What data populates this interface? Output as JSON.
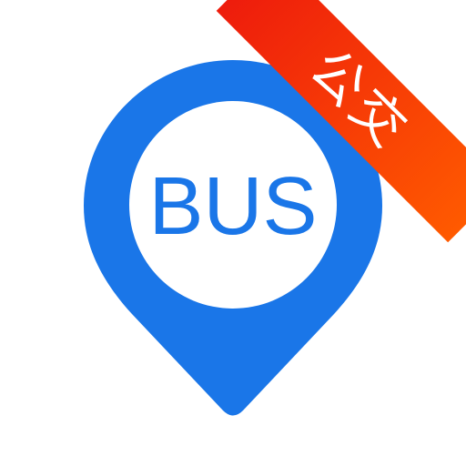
{
  "icon": {
    "label": "BUS",
    "ribbon_text": "公交",
    "pin_icon": "map-pin-icon",
    "colors": {
      "pin": "#1A76E8",
      "pin_inner": "#ffffff",
      "ribbon_start": "#EE1C0C",
      "ribbon_end": "#FF5A00",
      "ribbon_text": "#ffffff",
      "background": "#ffffff"
    }
  }
}
